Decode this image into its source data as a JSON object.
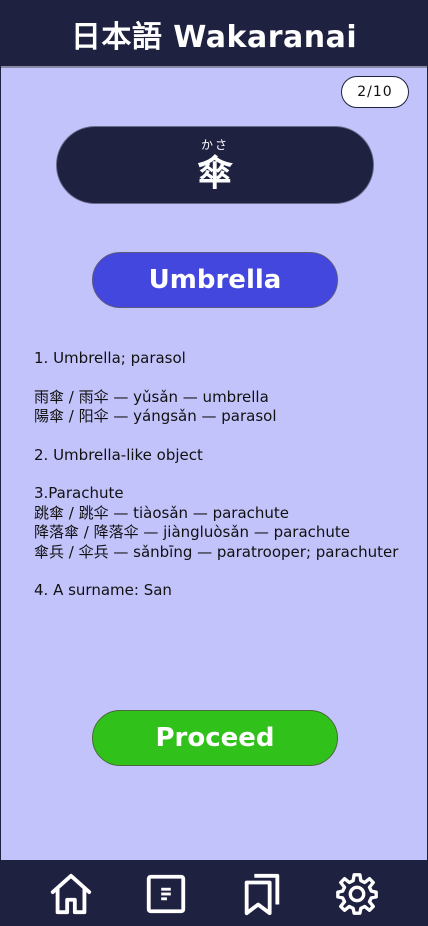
{
  "header": {
    "title": "日本語 Wakaranai"
  },
  "progress": {
    "counter": "2/10"
  },
  "kanji": {
    "reading": "かさ",
    "character": "傘"
  },
  "meaning": {
    "label": "Umbrella"
  },
  "definitions": [
    {
      "lines": [
        "1. Umbrella; parasol"
      ]
    },
    {
      "lines": [
        "雨傘 / 雨伞 — yǔsǎn — umbrella",
        "陽傘 / 阳伞 — yángsǎn — parasol"
      ]
    },
    {
      "lines": [
        "2. Umbrella-like object"
      ]
    },
    {
      "lines": [
        "3.Parachute",
        "跳傘 / 跳伞 — tiàosǎn — parachute",
        "降落傘 / 降落伞 — jiàngluòsǎn — parachute",
        "傘兵 / 伞兵 — sǎnbīng — paratrooper; parachuter"
      ]
    },
    {
      "lines": [
        "4. A surname: San"
      ]
    }
  ],
  "actions": {
    "proceed_label": "Proceed"
  },
  "nav": {
    "items": [
      {
        "icon": "home-icon"
      },
      {
        "icon": "document-icon"
      },
      {
        "icon": "bookmarks-icon"
      },
      {
        "icon": "gear-icon"
      }
    ]
  },
  "colors": {
    "background": "#c3c3fb",
    "navy": "#1e2140",
    "meaning_pill": "#4347dd",
    "proceed": "#30c21a"
  }
}
